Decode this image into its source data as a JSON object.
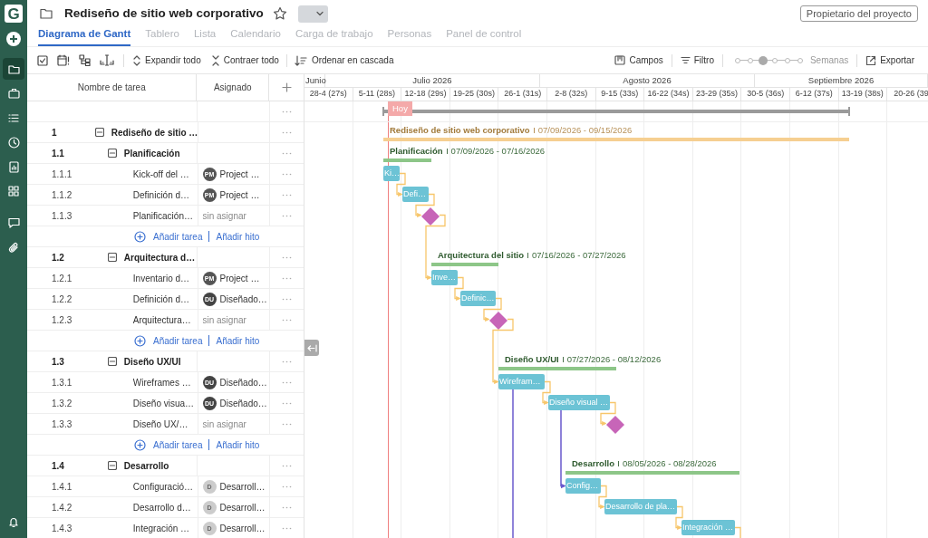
{
  "sidebar": {
    "logo": "G",
    "items": [
      {
        "selected": false
      },
      {
        "selected": true
      },
      {
        "selected": false
      },
      {
        "selected": false
      },
      {
        "selected": false
      },
      {
        "selected": false
      },
      {
        "selected": false
      },
      {
        "selected": false
      },
      {
        "selected": false
      },
      {
        "selected": false
      }
    ]
  },
  "header": {
    "title": "Rediseño de sitio web corporativo",
    "owner_button": "Propietario del proyecto"
  },
  "tabs": [
    {
      "label": "Diagrama de Gantt",
      "selected": true
    },
    {
      "label": "Tablero",
      "selected": false
    },
    {
      "label": "Lista",
      "selected": false
    },
    {
      "label": "Calendario",
      "selected": false
    },
    {
      "label": "Carga de trabajo",
      "selected": false
    },
    {
      "label": "Personas",
      "selected": false
    },
    {
      "label": "Panel de control",
      "selected": false
    }
  ],
  "toolbar": {
    "actions": [
      "Expandir todo",
      "Contraer todo",
      "Ordenar en cascada"
    ],
    "fields": "Campos",
    "filter": "Filtro",
    "zoom": {
      "level": 0.4,
      "label": "Semanas"
    },
    "export": "Exportar"
  },
  "table": {
    "columns": [
      "Nombre de tarea",
      "Asignado"
    ]
  },
  "timeline": {
    "months": [
      "Junio",
      "Julio 2026",
      "Agosto 2026",
      "Septiembre 2026"
    ],
    "weeks": [
      "28-4 (27s)",
      "5-11 (28s)",
      "12-18 (29s)",
      "19-25 (30s)",
      "26-1 (31s)",
      "2-8 (32s)",
      "9-15 (33s)",
      "16-22 (34s)",
      "23-29 (35s)",
      "30-5 (36s)",
      "6-12 (37s)",
      "13-19 (38s)",
      "20-26 (39"
    ],
    "today_label": "Hoy"
  },
  "tasks": [
    {
      "number": "1",
      "name": "Rediseño de sitio …",
      "expanded": true,
      "bar_title": "Rediseño de sitio web corporativo",
      "dates": "07/09/2026 - 09/15/2026",
      "children": [
        {
          "number": "1.1",
          "name": "Planificación",
          "expanded": true,
          "bar_title": "Planificación",
          "dates": "07/09/2026 - 07/16/2026",
          "add_task": "Añadir tarea",
          "add_milestone": "Añadir hito",
          "children": [
            {
              "number": "1.1.1",
              "name": "Kick-off del …",
              "kind": "task",
              "assignee": {
                "initials": "PM",
                "name": "Project …",
                "color": "#555555"
              },
              "bar_label": "Ki…"
            },
            {
              "number": "1.1.2",
              "name": "Definición d…",
              "kind": "task",
              "assignee": {
                "initials": "PM",
                "name": "Project …",
                "color": "#555555"
              },
              "bar_label": "Defi…"
            },
            {
              "number": "1.1.3",
              "name": "Planificación…",
              "kind": "milestone",
              "unassigned": "sin asignar"
            }
          ]
        },
        {
          "number": "1.2",
          "name": "Arquitectura d…",
          "expanded": true,
          "bar_title": "Arquitectura del sitio",
          "dates": "07/16/2026 - 07/27/2026",
          "add_task": "Añadir tarea",
          "add_milestone": "Añadir hito",
          "children": [
            {
              "number": "1.2.1",
              "name": "Inventario d…",
              "kind": "task",
              "assignee": {
                "initials": "PM",
                "name": "Project …",
                "color": "#555555"
              },
              "bar_label": "Inve…"
            },
            {
              "number": "1.2.2",
              "name": "Definición d…",
              "kind": "task",
              "assignee": {
                "initials": "DU",
                "name": "Diseñado…",
                "color": "#444444"
              },
              "bar_label": "Definic…"
            },
            {
              "number": "1.2.3",
              "name": "Arquitectura…",
              "kind": "milestone",
              "unassigned": "sin asignar"
            }
          ]
        },
        {
          "number": "1.3",
          "name": "Diseño UX/UI",
          "expanded": true,
          "bar_title": "Diseño UX/UI",
          "dates": "07/27/2026 - 08/12/2026",
          "add_task": "Añadir tarea",
          "add_milestone": "Añadir hito",
          "children": [
            {
              "number": "1.3.1",
              "name": "Wireframes …",
              "kind": "task",
              "assignee": {
                "initials": "DU",
                "name": "Diseñado…",
                "color": "#444444"
              },
              "bar_label": "Wirefram…"
            },
            {
              "number": "1.3.2",
              "name": "Diseño visua…",
              "kind": "task",
              "assignee": {
                "initials": "DU",
                "name": "Diseñado…",
                "color": "#444444"
              },
              "bar_label": "Diseño visual …"
            },
            {
              "number": "1.3.3",
              "name": "Diseño UX/…",
              "kind": "milestone",
              "unassigned": "sin asignar"
            }
          ]
        },
        {
          "number": "1.4",
          "name": "Desarrollo",
          "expanded": true,
          "bar_title": "Desarrollo",
          "dates": "08/05/2026 - 08/28/2026",
          "children": [
            {
              "number": "1.4.1",
              "name": "Configuració…",
              "kind": "task",
              "assignee": {
                "initials": "D",
                "name": "Desarroll…",
                "color": "#cccccc"
              },
              "bar_label": "Config…"
            },
            {
              "number": "1.4.2",
              "name": "Desarrollo d…",
              "kind": "task",
              "assignee": {
                "initials": "D",
                "name": "Desarroll…",
                "color": "#cccccc"
              },
              "bar_label": "Desarrollo de pla…"
            },
            {
              "number": "1.4.3",
              "name": "Integración …",
              "kind": "task",
              "assignee": {
                "initials": "D",
                "name": "Desarroll…",
                "color": "#cccccc"
              },
              "bar_label": "Integración …"
            }
          ]
        }
      ]
    }
  ]
}
